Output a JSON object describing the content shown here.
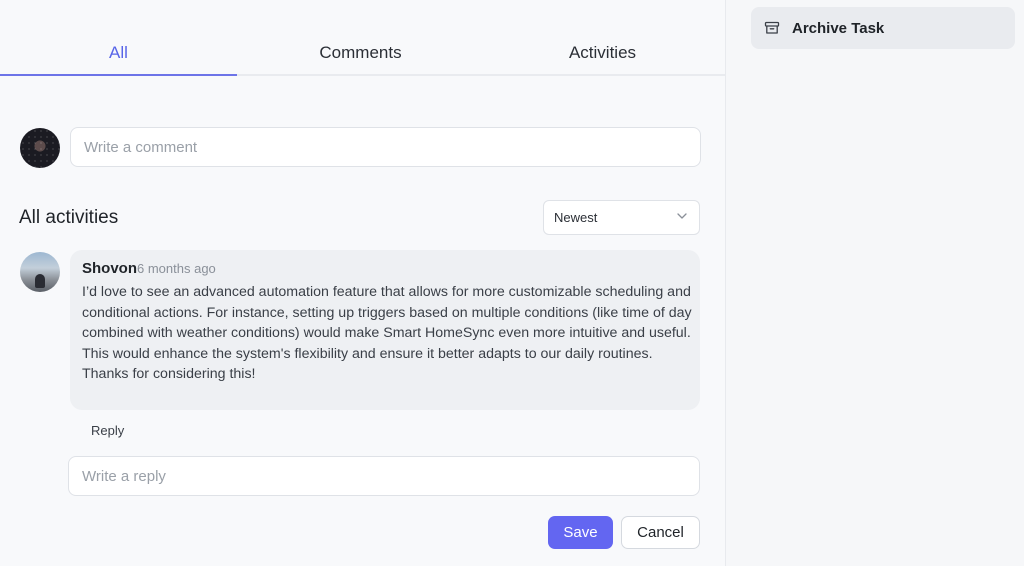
{
  "tabs": [
    {
      "label": "All",
      "active": true
    },
    {
      "label": "Comments",
      "active": false
    },
    {
      "label": "Activities",
      "active": false
    }
  ],
  "composer": {
    "placeholder": "Write a comment"
  },
  "activities": {
    "heading": "All activities",
    "sort": {
      "selected": "Newest"
    }
  },
  "comment": {
    "author": "Shovon",
    "time": "6 months ago",
    "body": "I’d love to see an advanced automation feature that allows for more customizable scheduling and conditional actions. For instance, setting up triggers based on multiple conditions (like time of day combined with weather conditions) would make Smart HomeSync even more intuitive and useful. This would enhance the system's flexibility and ensure it better adapts to our daily routines. Thanks for considering this!",
    "reply_label": "Reply"
  },
  "reply": {
    "placeholder": "Write a reply",
    "save_label": "Save",
    "cancel_label": "Cancel"
  },
  "sidebar": {
    "archive_label": "Archive Task"
  },
  "colors": {
    "accent": "#6366f1",
    "active_tab": "#5865e8"
  }
}
